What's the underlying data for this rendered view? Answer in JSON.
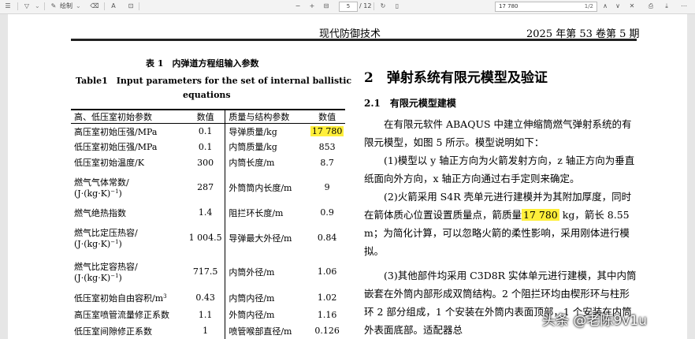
{
  "toolbar": {
    "draw_label": "绘制",
    "page_current": "5",
    "page_total": "/ 12",
    "find_query": "17 780",
    "find_count": "1/2"
  },
  "header": {
    "journal": "现代防御技术",
    "volume": "2025 年第 53 卷第 5 期"
  },
  "table": {
    "title_cn": "表 1　内弹道方程组输入参数",
    "title_en_1": "Table1　Input parameters for the set of internal ballistic",
    "title_en_2": "equations",
    "col1": "高、低压室初始参数",
    "col2": "数值",
    "col3": "质量与结构参数",
    "col4": "数值",
    "rows": [
      {
        "p1": "高压室初始压强/MPa",
        "v1": "0.1",
        "p2": "导弹质量/kg",
        "v2": "17 780"
      },
      {
        "p1": "低压室初始压强/MPa",
        "v1": "0.1",
        "p2": "内筒质量/kg",
        "v2": "853"
      },
      {
        "p1": "低压室初始温度/K",
        "v1": "300",
        "p2": "内筒长度/m",
        "v2": "8.7"
      },
      {
        "p1": "燃气气体常数/",
        "p1b": "(J·(kg·K)",
        "p1sup": "−1",
        "p1c": ")",
        "v1": "287",
        "p2": "外筒筒内长度/m",
        "v2": "9"
      },
      {
        "p1": "燃气绝热指数",
        "v1": "1.4",
        "p2": "阻拦环长度/m",
        "v2": "0.9"
      },
      {
        "p1": "燃气比定压热容/",
        "p1b": "(J·(kg·K)",
        "p1sup": "−1",
        "p1c": ")",
        "v1": "1 004.5",
        "p2": "导弹最大外径/m",
        "v2": "0.84"
      },
      {
        "p1": "燃气比定容热容/",
        "p1b": "(J·(kg·K)",
        "p1sup": "−1",
        "p1c": ")",
        "v1": "717.5",
        "p2": "内筒外径/m",
        "v2": "1.06"
      },
      {
        "p1": "低压室初始自由容积/m",
        "p1sup": "3",
        "v1": "0.43",
        "p2": "内筒内径/m",
        "v2": "1.02"
      },
      {
        "p1": "高压室喷管流量修正系数",
        "v1": "1.1",
        "p2": "外筒内径/m",
        "v2": "1.16"
      },
      {
        "p1": "低压室间隙修正系数",
        "v1": "1",
        "p2": "喷管喉部直径/m",
        "v2": "0.126"
      }
    ]
  },
  "article": {
    "section": "2　弹射系统有限元模型及验证",
    "subsection": "2.1　有限元模型建模",
    "p1": "在有限元软件 ABAQUS 中建立伸缩筒燃气弹射系统的有限元模型，如图 5 所示。模型说明如下：",
    "p2": "(1)模型以 y 轴正方向为火箭发射方向，z 轴正方向为垂直纸面向外方向，x 轴正方向通过右手定则来确定。",
    "p3a": "(2)火箭采用 S4R 壳单元进行建模并为其附加厚度，同时在箭体质心位置设置质量点，箭质量",
    "p3hl": "17 780",
    "p3b": " kg，箭长 8.55 m；为简化计算，可以忽略火箭的柔性影响，采用刚体进行模拟。",
    "p4": "(3)其他部件均采用 C3D8R 实体单元进行建模，其中内筒嵌套在外筒内部形成双筒结构。2 个阻拦环均由楔形环与柱形环 2 部分组成，1 个安装在外筒内表面顶部，1 个安装在内筒外表面底部。适配器总"
  },
  "watermark": "头条 @老陈9v1u"
}
